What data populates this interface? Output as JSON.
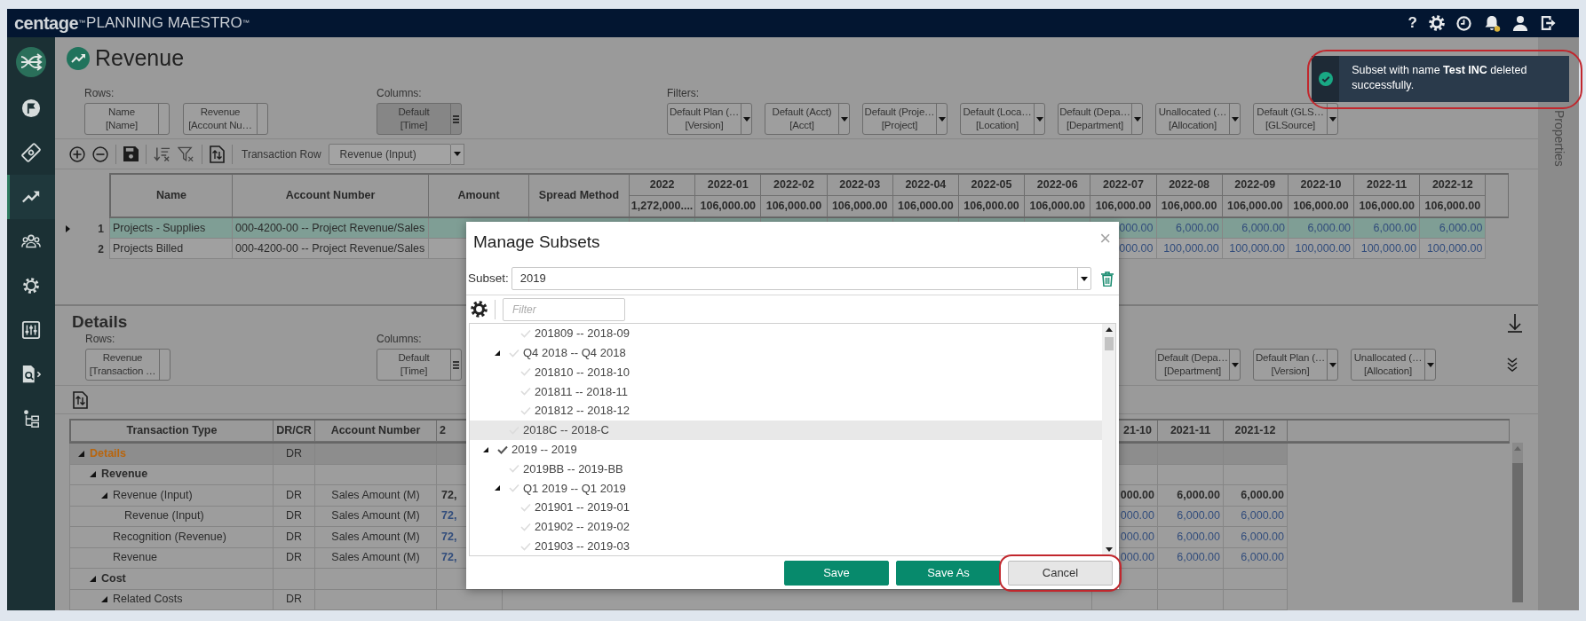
{
  "topbar": {
    "logo": "centage",
    "logo_mark": "™",
    "product": "PLANNING MAESTRO",
    "product_mark": "™",
    "help": "?",
    "notifications_unread": true
  },
  "sidebar": {
    "items": [
      {
        "selected": false
      },
      {
        "selected": false
      },
      {
        "selected": true
      },
      {
        "selected": false
      },
      {
        "selected": false
      },
      {
        "selected": false
      },
      {
        "selected": false
      },
      {
        "selected": false
      }
    ]
  },
  "page": {
    "title": "Revenue"
  },
  "pivot": {
    "rows_label": "Rows:",
    "rows": [
      {
        "line1": "Name",
        "line2": "[Name]"
      },
      {
        "line1": "Revenue",
        "line2": "[Account Nu…"
      }
    ],
    "columns_label": "Columns:",
    "columns": [
      {
        "line1": "Default",
        "line2": "[Time]",
        "selected": true
      }
    ],
    "filters_label": "Filters:",
    "filters": [
      {
        "line1": "Default Plan (…",
        "line2": "[Version]"
      },
      {
        "line1": "Default (Acct)",
        "line2": "[Acct]"
      },
      {
        "line1": "Default (Proje…",
        "line2": "[Project]"
      },
      {
        "line1": "Default (Loca…",
        "line2": "[Location]"
      },
      {
        "line1": "Default (Depa…",
        "line2": "[Department]"
      },
      {
        "line1": "Unallocated (…",
        "line2": "[Allocation]"
      },
      {
        "line1": "Default (GLS…",
        "line2": "[GLSource]"
      }
    ]
  },
  "toolbar": {
    "transaction_row_label": "Transaction Row",
    "transaction_row_value": "Revenue (Input)"
  },
  "grid": {
    "columns": [
      "Name",
      "Account Number",
      "Amount",
      "Spread Method"
    ],
    "periods": [
      {
        "label": "2022",
        "total": "1,272,000...."
      },
      {
        "label": "2022-01",
        "total": "106,000.00"
      },
      {
        "label": "2022-02",
        "total": "106,000.00"
      },
      {
        "label": "2022-03",
        "total": "106,000.00"
      },
      {
        "label": "2022-04",
        "total": "106,000.00"
      },
      {
        "label": "2022-05",
        "total": "106,000.00"
      },
      {
        "label": "2022-06",
        "total": "106,000.00"
      },
      {
        "label": "2022-07",
        "total": "106,000.00"
      },
      {
        "label": "2022-08",
        "total": "106,000.00"
      },
      {
        "label": "2022-09",
        "total": "106,000.00"
      },
      {
        "label": "2022-10",
        "total": "106,000.00"
      },
      {
        "label": "2022-11",
        "total": "106,000.00"
      },
      {
        "label": "2022-12",
        "total": "106,000.00"
      }
    ],
    "rows": [
      {
        "number": "1",
        "selected": true,
        "name": "Projects - Supplies",
        "account": "000-4200-00 -- Project Revenue/Sales",
        "values": [
          "000.00",
          "6,000.00",
          "6,000.00",
          "6,000.00",
          "6,000.00",
          "6,000.00"
        ]
      },
      {
        "number": "2",
        "selected": false,
        "name": "Projects Billed",
        "account": "000-4200-00 -- Project Revenue/Sales",
        "values": [
          "000.00",
          "100,000.00",
          "100,000.00",
          "100,000.00",
          "100,000.00",
          "100,000.00"
        ]
      }
    ]
  },
  "details": {
    "title": "Details",
    "rows_label": "Rows:",
    "rows": [
      {
        "line1": "Revenue",
        "line2": "[Transaction …"
      }
    ],
    "columns_label": "Columns:",
    "columns": [
      {
        "line1": "Default",
        "line2": "[Time]",
        "selected": false
      }
    ],
    "filters": [
      {
        "line1": "Default (Depa…",
        "line2": "[Department]"
      },
      {
        "line1": "Default Plan (…",
        "line2": "[Version]"
      },
      {
        "line1": "Unallocated (…",
        "line2": "[Allocation]"
      }
    ],
    "table": {
      "columns": [
        "Transaction Type",
        "DR/CR",
        "Account Number"
      ],
      "lead_period": "2",
      "periods": [
        "21-10",
        "2021-11",
        "2021-12"
      ],
      "rows": [
        {
          "name": "Details",
          "kind": "root",
          "drcr": "DR",
          "expanded": true,
          "children": [
            {
              "name": "Revenue",
              "kind": "group",
              "expanded": true,
              "children": [
                {
                  "name": "Revenue (Input)",
                  "kind": "total",
                  "expanded": true,
                  "drcr": "DR",
                  "account": "Sales Amount (M)",
                  "lead_value": "72,",
                  "values": [
                    "000.00",
                    "6,000.00",
                    "6,000.00"
                  ],
                  "children": [
                    {
                      "name": "Revenue (Input)",
                      "kind": "leaf",
                      "drcr": "DR",
                      "account": "Sales Amount (M)",
                      "lead_value": "72,",
                      "values": [
                        "000.00",
                        "6,000.00",
                        "6,000.00"
                      ]
                    }
                  ]
                },
                {
                  "name": "Recognition (Revenue)",
                  "kind": "leaf",
                  "drcr": "DR",
                  "account": "Sales Amount (M)",
                  "lead_value": "72,",
                  "values": [
                    "000.00",
                    "6,000.00",
                    "6,000.00"
                  ]
                },
                {
                  "name": "Revenue",
                  "kind": "leaf",
                  "drcr": "DR",
                  "account": "Sales Amount (M)",
                  "lead_value": "72,",
                  "values": [
                    "000.00",
                    "6,000.00",
                    "6,000.00"
                  ]
                }
              ]
            },
            {
              "name": "Cost",
              "kind": "group",
              "expanded": true,
              "children": [
                {
                  "name": "Related Costs",
                  "kind": "total",
                  "expanded": true,
                  "drcr": "DR"
                }
              ]
            }
          ]
        }
      ]
    }
  },
  "properties_tab": {
    "label": "Properties"
  },
  "toast": {
    "message": "Subset with name **Test INC** deleted successfully.",
    "highlighted": true
  },
  "dialog": {
    "title": "Manage Subsets",
    "close": "×",
    "subset_label": "Subset:",
    "subset_value": "2019",
    "filter_placeholder": "Filter",
    "tree": [
      {
        "children": [
          {
            "children": [
              {
                "label": "201809 -- 2018-09",
                "checked": false,
                "selected": false
              }
            ]
          },
          {
            "label": "Q4 2018 -- Q4 2018",
            "checked": false,
            "selected": false,
            "expanded": true,
            "children": [
              {
                "label": "201810 -- 2018-10",
                "checked": false,
                "selected": false
              },
              {
                "label": "201811 -- 2018-11",
                "checked": false,
                "selected": false
              },
              {
                "label": "201812 -- 2018-12",
                "checked": false,
                "selected": false
              }
            ]
          },
          {
            "label": "2018C -- 2018-C",
            "checked": false,
            "selected": true
          }
        ]
      },
      {
        "label": "2019 -- 2019",
        "checked": true,
        "selected": false,
        "expanded": true,
        "children": [
          {
            "label": "2019BB -- 2019-BB",
            "checked": false,
            "selected": false
          },
          {
            "label": "Q1 2019 -- Q1 2019",
            "checked": false,
            "selected": false,
            "expanded": true,
            "children": [
              {
                "label": "201901 -- 2019-01",
                "checked": false,
                "selected": false
              },
              {
                "label": "201902 -- 2019-02",
                "checked": false,
                "selected": false
              },
              {
                "label": "201903 -- 2019-03",
                "checked": false,
                "selected": false
              }
            ]
          }
        ]
      }
    ],
    "buttons": [
      {
        "label": "Save",
        "kind": "primary",
        "highlighted": false
      },
      {
        "label": "Save As",
        "kind": "primary",
        "highlighted": false
      },
      {
        "label": "Cancel",
        "kind": "secondary",
        "highlighted": true
      }
    ]
  }
}
